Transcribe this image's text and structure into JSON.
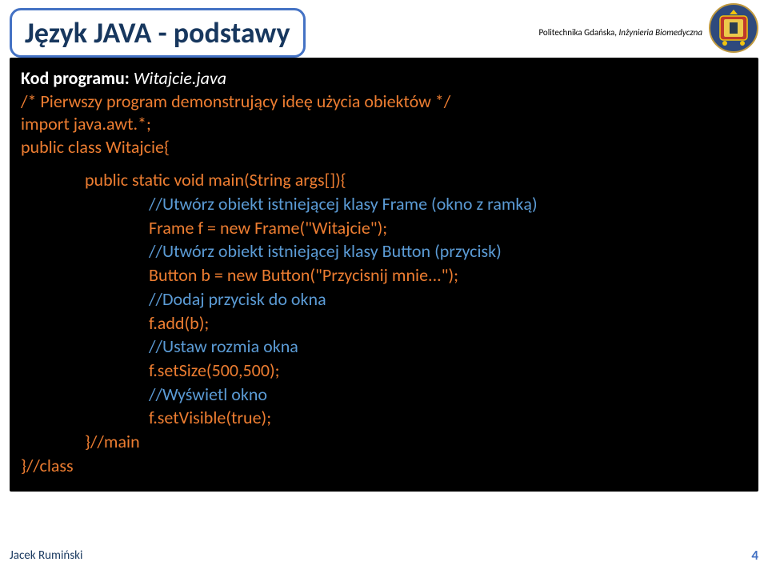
{
  "title": "Język JAVA - podstawy",
  "subtitle_plain": "Politechnika Gdańska, ",
  "subtitle_italic": "Inżynieria Biomedyczna",
  "header": {
    "label": "Kod programu: ",
    "program": "Witajcie.java",
    "line1": "/* Pierwszy program demonstrujący ideę użycia obiektów */",
    "line2": "import java.awt.*;",
    "line3": "public class Witajcie{"
  },
  "body": {
    "method": "public static void main(String args[]){",
    "c1": "//Utwórz obiekt istniejącej klasy Frame (okno z ramką)",
    "code1": "Frame f = new Frame(\"Witajcie\");",
    "c2": "//Utwórz obiekt istniejącej klasy Button (przycisk)",
    "code2": "Button b = new Button(\"Przycisnij mnie...\");",
    "c3": "//Dodaj przycisk do okna",
    "code3": "f.add(b);",
    "c4": "//Ustaw rozmia okna",
    "code4": "f.setSize(500,500);",
    "c5": "//Wyświetl okno",
    "code5": "f.setVisible(true);",
    "closeMain": "}//main",
    "closeClass": "}//class"
  },
  "footer": {
    "author": "Jacek Rumiński",
    "page": "4"
  }
}
